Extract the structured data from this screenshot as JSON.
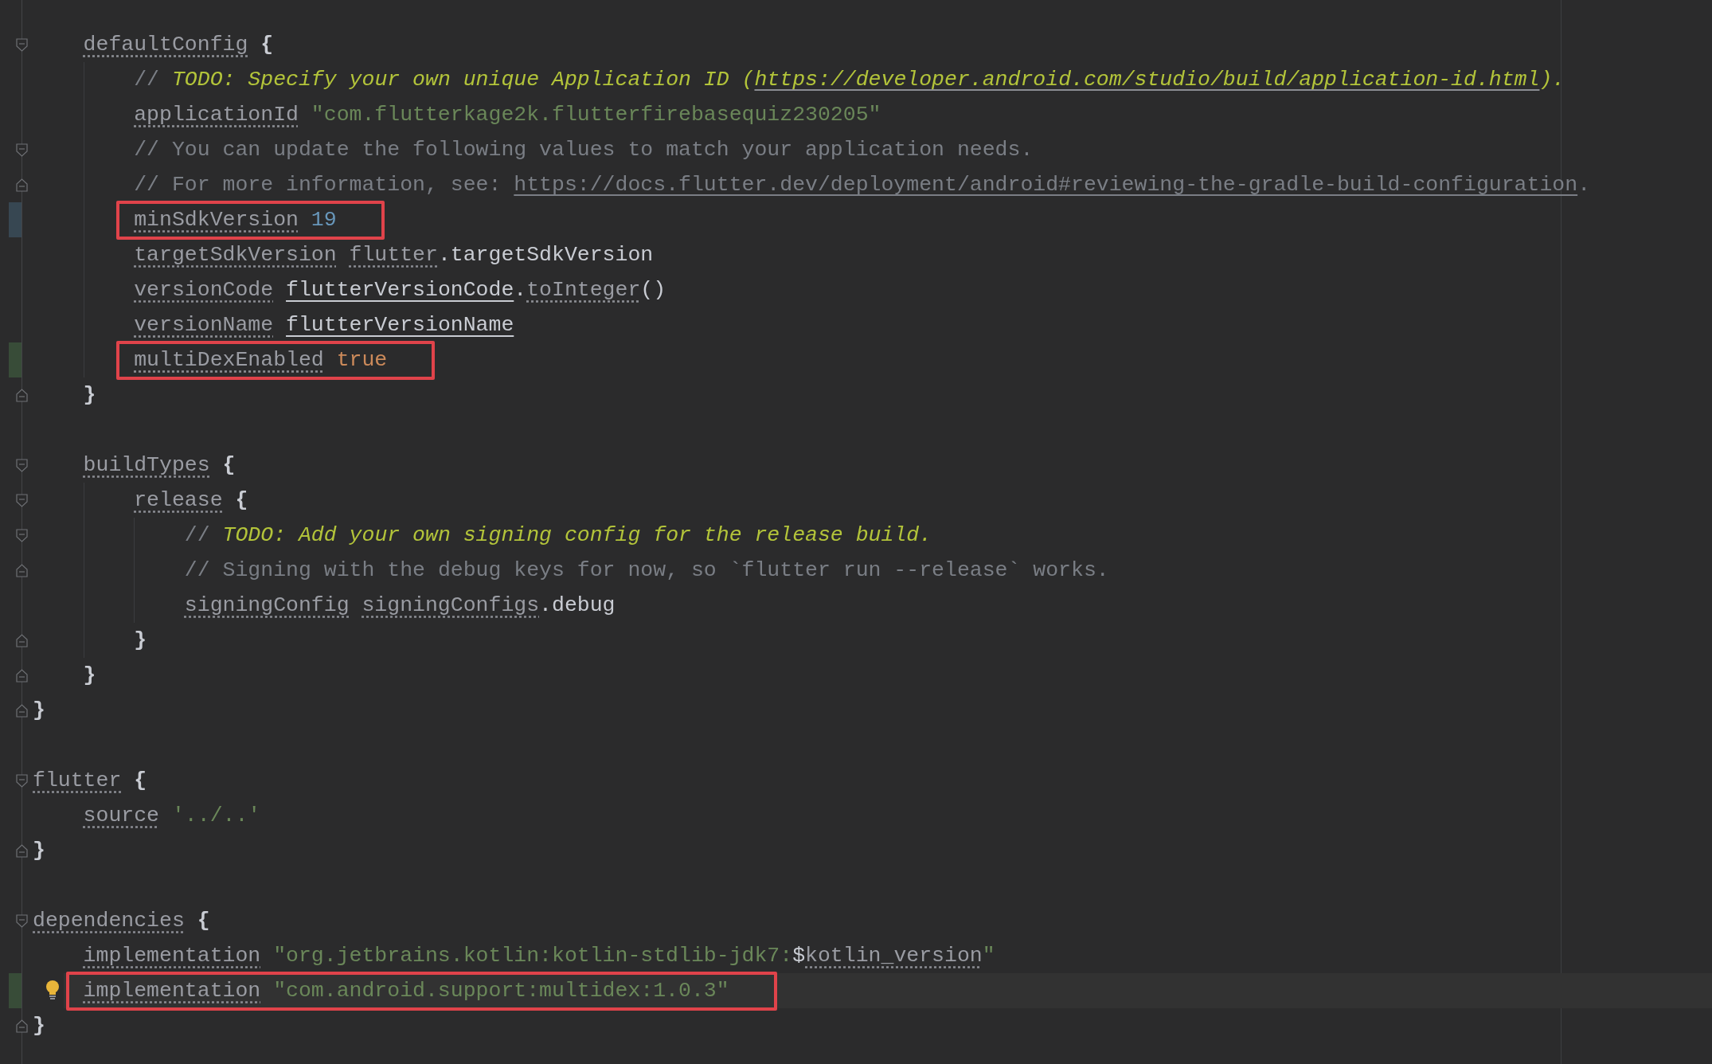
{
  "lines": [
    {
      "children": [
        {
          "opens_fold": true,
          "tokens": [
            {
              "text": "defaultConfig",
              "kind": "prop"
            },
            {
              "text": "{",
              "kind": "brace",
              "gap": true
            }
          ],
          "children": [
            {
              "tokens": [
                {
                  "text": "// ",
                  "kind": "comment"
                },
                {
                  "text": "TODO: Specify your own unique Application ID (",
                  "kind": "todo"
                },
                {
                  "text": "https://developer.android.com/studio/build/application-id.html",
                  "kind": "todo-link"
                },
                {
                  "text": ").",
                  "kind": "todo"
                }
              ]
            },
            {
              "tokens": [
                {
                  "text": "applicationId",
                  "kind": "prop"
                },
                {
                  "text": "\"com.flutterkage2k.flutterfirebasequiz230205\"",
                  "kind": "string",
                  "gap": true
                }
              ]
            },
            {
              "opens_fold": true,
              "tokens": [
                {
                  "text": "// You can update the following values to match your application needs.",
                  "kind": "comment"
                }
              ]
            },
            {
              "closes_fold": true,
              "tokens": [
                {
                  "text": "// For more information, see: ",
                  "kind": "comment"
                },
                {
                  "text": "https://docs.flutter.dev/deployment/android#reviewing-the-gradle-build-configuration",
                  "kind": "comment-link"
                },
                {
                  "text": ".",
                  "kind": "comment"
                }
              ]
            },
            {
              "color": "#374752",
              "boxed": true,
              "tokens": [
                {
                  "text": "minSdkVersion",
                  "kind": "prop"
                },
                {
                  "text": "19",
                  "kind": "number",
                  "gap": true
                }
              ]
            },
            {
              "tokens": [
                {
                  "text": "targetSdkVersion",
                  "kind": "prop"
                },
                {
                  "text": "flutter",
                  "kind": "prop",
                  "gap": true
                },
                {
                  "text": ".targetSdkVersion"
                }
              ]
            },
            {
              "tokens": [
                {
                  "text": "versionCode",
                  "kind": "prop"
                },
                {
                  "text": "flutterVersionCode",
                  "kind": "ref",
                  "gap": true
                },
                {
                  "text": "."
                },
                {
                  "text": "toInteger",
                  "kind": "prop"
                },
                {
                  "text": "()"
                }
              ]
            },
            {
              "tokens": [
                {
                  "text": "versionName",
                  "kind": "prop"
                },
                {
                  "text": "flutterVersionName",
                  "kind": "ref",
                  "gap": true
                }
              ]
            },
            {
              "color": "#384c38",
              "boxed": true,
              "tokens": [
                {
                  "text": "multiDexEnabled",
                  "kind": "prop"
                },
                {
                  "text": "true",
                  "kind": "keyword",
                  "gap": true
                }
              ]
            }
          ]
        },
        {
          "closes_fold": true,
          "tokens": [
            {
              "text": "}",
              "kind": "brace"
            }
          ]
        },
        {
          "kind": "blank"
        },
        {
          "opens_fold": true,
          "tokens": [
            {
              "text": "buildTypes",
              "kind": "prop"
            },
            {
              "text": "{",
              "kind": "brace",
              "gap": true
            }
          ],
          "children": [
            {
              "opens_fold": true,
              "tokens": [
                {
                  "text": "release",
                  "kind": "prop"
                },
                {
                  "text": "{",
                  "kind": "brace",
                  "gap": true
                }
              ],
              "children": [
                {
                  "opens_fold": true,
                  "tokens": [
                    {
                      "text": "// ",
                      "kind": "comment"
                    },
                    {
                      "text": "TODO: Add your own signing config for the release build.",
                      "kind": "todo"
                    }
                  ]
                },
                {
                  "closes_fold": true,
                  "tokens": [
                    {
                      "text": "// Signing with the debug keys for now, so `flutter run --release` works.",
                      "kind": "comment"
                    }
                  ]
                },
                {
                  "tokens": [
                    {
                      "text": "signingConfig",
                      "kind": "prop"
                    },
                    {
                      "text": "signingConfigs",
                      "kind": "prop",
                      "gap": true
                    },
                    {
                      "text": ".debug"
                    }
                  ]
                }
              ]
            },
            {
              "closes_fold": true,
              "tokens": [
                {
                  "text": "}",
                  "kind": "brace"
                }
              ]
            }
          ]
        },
        {
          "closes_fold": true,
          "tokens": [
            {
              "text": "}",
              "kind": "brace"
            }
          ]
        }
      ]
    },
    {
      "closes_fold": true,
      "tokens": [
        {
          "text": "}",
          "kind": "brace"
        }
      ]
    },
    {
      "kind": "blank"
    },
    {
      "opens_fold": true,
      "tokens": [
        {
          "text": "flutter",
          "kind": "prop"
        },
        {
          "text": "{",
          "kind": "brace",
          "gap": true
        }
      ],
      "children": [
        {
          "tokens": [
            {
              "text": "source",
              "kind": "prop"
            },
            {
              "text": "'../..'",
              "kind": "string",
              "gap": true
            }
          ]
        }
      ]
    },
    {
      "closes_fold": true,
      "tokens": [
        {
          "text": "}",
          "kind": "brace"
        }
      ]
    },
    {
      "kind": "blank"
    },
    {
      "opens_fold": true,
      "tokens": [
        {
          "text": "dependencies",
          "kind": "prop"
        },
        {
          "text": "{",
          "kind": "brace",
          "gap": true
        }
      ],
      "children": [
        {
          "tokens": [
            {
              "text": "implementation",
              "kind": "prop"
            },
            {
              "text": "\"org.jetbrains.kotlin:kotlin-stdlib-jdk7:",
              "kind": "string",
              "gap": true
            },
            {
              "text": "$"
            },
            {
              "text": "kotlin_version",
              "kind": "prop"
            },
            {
              "text": "\"",
              "kind": "string"
            }
          ]
        },
        {
          "color": "#384c38",
          "boxed": true,
          "current": true,
          "hint": true,
          "tokens": [
            {
              "text": "implementation",
              "kind": "prop"
            },
            {
              "text": "\"com.android.support:multidex:1.0.3\"",
              "kind": "string",
              "gap": true
            }
          ]
        }
      ]
    },
    {
      "closes_fold": true,
      "tokens": [
        {
          "text": "}",
          "kind": "brace"
        }
      ]
    }
  ]
}
